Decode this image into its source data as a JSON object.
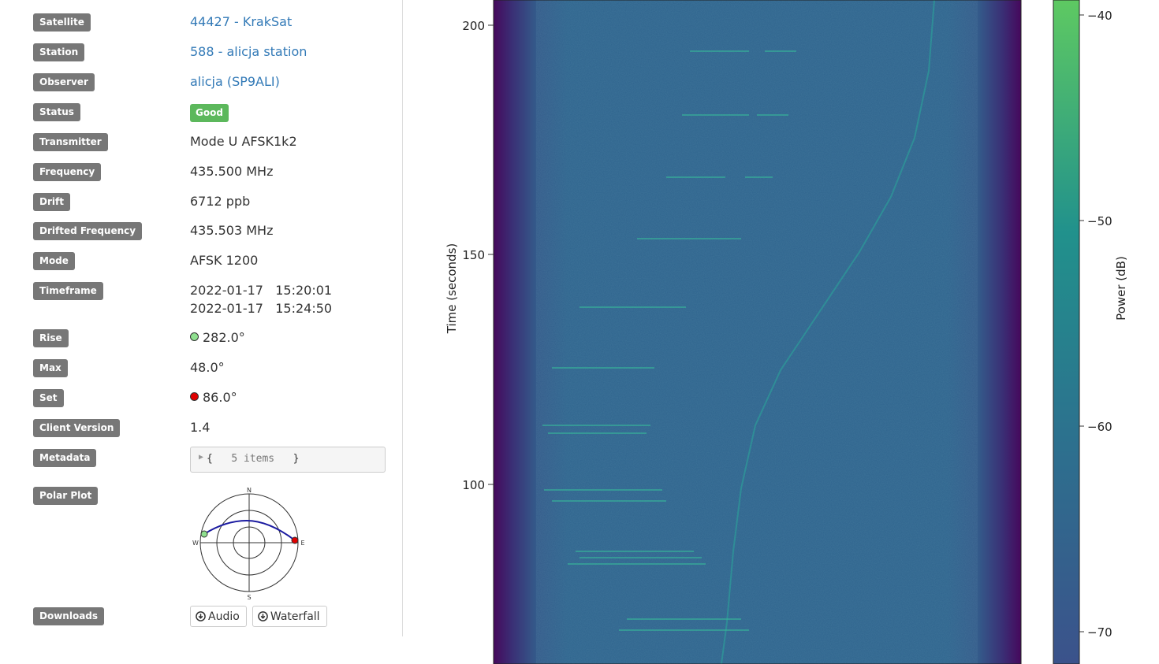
{
  "details": {
    "satellite": {
      "label": "Satellite",
      "value": "44427 - KrakSat"
    },
    "station": {
      "label": "Station",
      "value": "588 - alicja station"
    },
    "observer": {
      "label": "Observer",
      "value": "alicja (SP9ALI)"
    },
    "status": {
      "label": "Status",
      "value": "Good"
    },
    "transmitter": {
      "label": "Transmitter",
      "value": "Mode U AFSK1k2"
    },
    "frequency": {
      "label": "Frequency",
      "value": "435.500 MHz"
    },
    "drift": {
      "label": "Drift",
      "value": "6712 ppb"
    },
    "drifted_frequency": {
      "label": "Drifted Frequency",
      "value": "435.503 MHz"
    },
    "mode": {
      "label": "Mode",
      "value": "AFSK 1200"
    },
    "timeframe": {
      "label": "Timeframe",
      "start": "2022-01-17   15:20:01",
      "end": "2022-01-17   15:24:50"
    },
    "rise": {
      "label": "Rise",
      "value": "282.0°"
    },
    "max": {
      "label": "Max",
      "value": "48.0°"
    },
    "set": {
      "label": "Set",
      "value": "86.0°"
    },
    "client_version": {
      "label": "Client Version",
      "value": "1.4"
    },
    "metadata": {
      "label": "Metadata",
      "open": "{",
      "summary": "5 items",
      "close": "}"
    },
    "polar_plot": {
      "label": "Polar Plot",
      "north": "N",
      "south": "S",
      "east": "E",
      "west": "W",
      "rise_azimuth_deg": 282.0,
      "max_elevation_deg": 48.0,
      "set_azimuth_deg": 86.0
    },
    "downloads": {
      "label": "Downloads",
      "audio": "Audio",
      "waterfall": "Waterfall"
    }
  },
  "waterfall": {
    "ylabel": "Time (seconds)",
    "yticks": [
      "200",
      "150",
      "100"
    ],
    "colorbar_label": "Power (dB)",
    "colorbar_ticks": [
      "−40",
      "−50",
      "−60",
      "−70"
    ],
    "colormap": [
      "#440154",
      "#3b528b",
      "#21918c",
      "#5ec962"
    ]
  }
}
